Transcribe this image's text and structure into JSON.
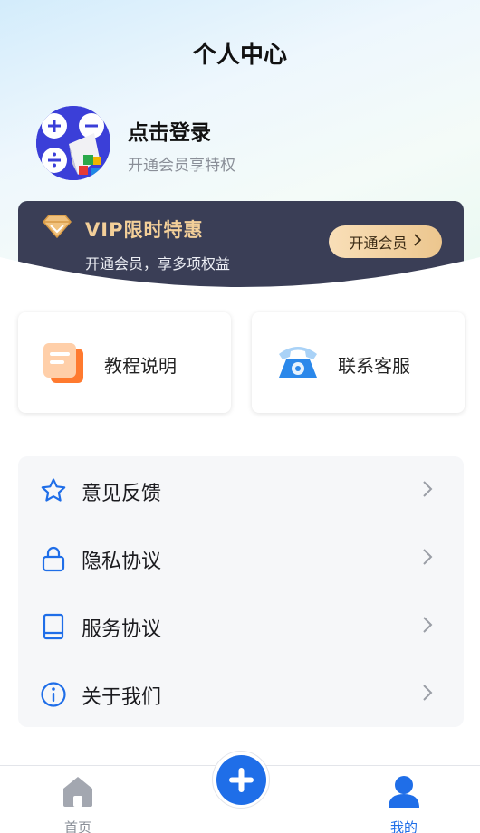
{
  "header": {
    "title": "个人中心"
  },
  "profile": {
    "login_text": "点击登录",
    "subtitle": "开通会员享特权"
  },
  "vip": {
    "title": "VIP限时特惠",
    "subtitle": "开通会员，享多项权益",
    "button_label": "开通会员",
    "accent_color": "#f3cf99",
    "background_color": "#3a3e56"
  },
  "quick_actions": [
    {
      "label": "教程说明",
      "icon": "document-icon"
    },
    {
      "label": "联系客服",
      "icon": "telephone-icon"
    }
  ],
  "menu": [
    {
      "label": "意见反馈",
      "icon": "star-icon"
    },
    {
      "label": "隐私协议",
      "icon": "lock-icon"
    },
    {
      "label": "服务协议",
      "icon": "book-icon"
    },
    {
      "label": "关于我们",
      "icon": "info-icon"
    }
  ],
  "tabbar": {
    "items": [
      {
        "label": "首页",
        "icon": "home-icon",
        "active": false
      },
      {
        "label": "我的",
        "icon": "person-icon",
        "active": true
      }
    ],
    "center_button_icon": "plus-icon",
    "active_color": "#1f6ee8",
    "inactive_color": "#8a8f98"
  }
}
